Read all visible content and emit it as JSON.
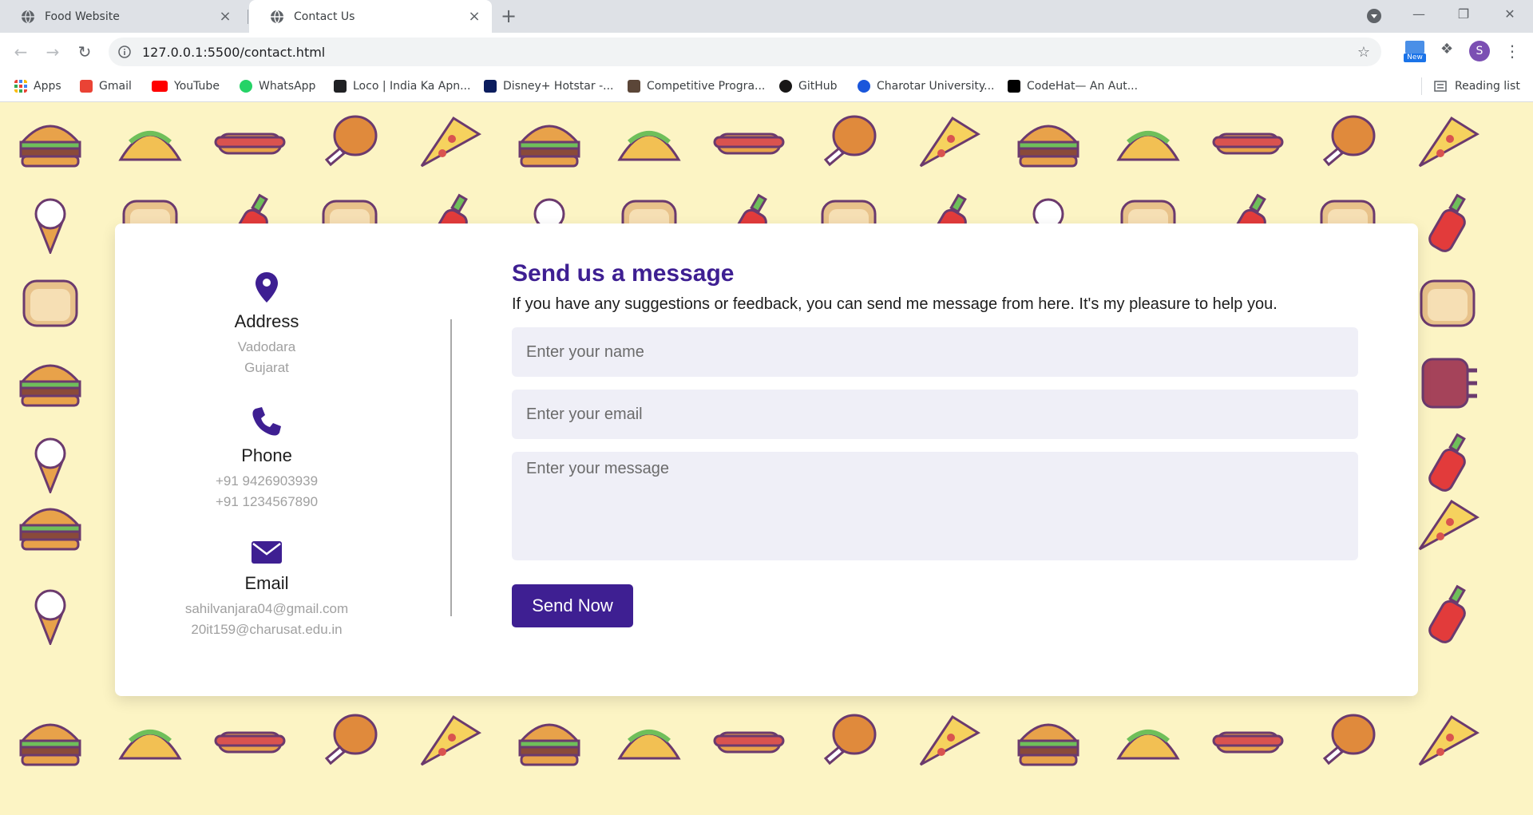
{
  "tabs": [
    {
      "title": "Food Website",
      "active": false
    },
    {
      "title": "Contact Us",
      "active": true
    }
  ],
  "address_bar": {
    "url": "127.0.0.1:5500/contact.html"
  },
  "extensions": {
    "new_badge": "New"
  },
  "profile_initial": "S",
  "bookmarks": [
    {
      "label": "Apps",
      "icon": "apps-grid-icon",
      "color": "#ea4335"
    },
    {
      "label": "Gmail",
      "icon": "gmail-icon",
      "color": "#ea4335"
    },
    {
      "label": "YouTube",
      "icon": "youtube-icon",
      "color": "#ff0000"
    },
    {
      "label": "WhatsApp",
      "icon": "whatsapp-icon",
      "color": "#25d366"
    },
    {
      "label": "Loco | India Ka Apn...",
      "icon": "loco-icon",
      "color": "#202124"
    },
    {
      "label": "Disney+ Hotstar -...",
      "icon": "hotstar-icon",
      "color": "#0c1d5e"
    },
    {
      "label": "Competitive Progra...",
      "icon": "codechef-icon",
      "color": "#5b4638"
    },
    {
      "label": "GitHub",
      "icon": "github-icon",
      "color": "#181717"
    },
    {
      "label": "Charotar University...",
      "icon": "charusat-icon",
      "color": "#1a56db"
    },
    {
      "label": "CodeHat— An Aut...",
      "icon": "medium-icon",
      "color": "#000000"
    }
  ],
  "reading_list": "Reading list",
  "contact": {
    "address": {
      "title": "Address",
      "lines": [
        "Vadodara",
        "Gujarat"
      ]
    },
    "phone": {
      "title": "Phone",
      "lines": [
        "+91 9426903939",
        "+91 1234567890"
      ]
    },
    "email": {
      "title": "Email",
      "lines": [
        "sahilvanjara04@gmail.com",
        "20it159@charusat.edu.in"
      ]
    }
  },
  "form": {
    "title": "Send us a message",
    "text": "If you have any suggestions or feedback, you can send me message from here. It's my pleasure to help you.",
    "name_placeholder": "Enter your name",
    "email_placeholder": "Enter your email",
    "message_placeholder": "Enter your message",
    "submit_label": "Send Now"
  },
  "colors": {
    "accent": "#3e1f92",
    "background": "#fcf4c4",
    "field": "#efeff7"
  }
}
